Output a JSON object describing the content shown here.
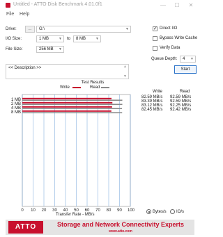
{
  "window": {
    "title": "Untitled - ATTO Disk Benchmark 4.01.0f1",
    "minimize_glyph": "—",
    "maximize_glyph": "☐",
    "close_glyph": "✕"
  },
  "menu": {
    "file": "File",
    "help": "Help"
  },
  "form": {
    "drive_label": "Drive:",
    "drive_browse": "...",
    "drive_value": "G:\\",
    "io_size_label": "I/O Size:",
    "io_from": "1 MB",
    "io_to_label": "to",
    "io_to": "8 MB",
    "file_size_label": "File Size:",
    "file_size": "256 MB",
    "description_placeholder": "<< Description >>"
  },
  "options": {
    "direct_io": "Direct I/O",
    "bypass_write_cache": "Bypass Write Cache",
    "verify_data": "Verify Data",
    "queue_depth_label": "Queue Depth:",
    "queue_depth": "4",
    "start": "Start"
  },
  "chart_data": {
    "type": "bar",
    "title": "Test Results",
    "legend": [
      "Write",
      "Read"
    ],
    "categories": [
      "1 MB",
      "2 MB",
      "4 MB",
      "8 MB"
    ],
    "series": [
      {
        "name": "Write",
        "values": [
          82.59,
          83.39,
          83.12,
          82.45
        ],
        "color": "#c8102e"
      },
      {
        "name": "Read",
        "values": [
          92.59,
          92.59,
          92.25,
          92.42
        ],
        "color": "#8a8a8a"
      }
    ],
    "xlabel": "Transfer Rate - MB/s",
    "xticks": [
      "0",
      "10",
      "20",
      "30",
      "40",
      "50",
      "60",
      "70",
      "80",
      "90",
      "100"
    ],
    "xlim": [
      0,
      100
    ],
    "grid": true
  },
  "results": {
    "write_header": "Write",
    "read_header": "Read",
    "rows": [
      {
        "write": "82.59 MB/s",
        "read": "92.59 MB/s"
      },
      {
        "write": "83.39 MB/s",
        "read": "92.59 MB/s"
      },
      {
        "write": "83.12 MB/s",
        "read": "92.25 MB/s"
      },
      {
        "write": "82.45 MB/s",
        "read": "92.42 MB/s"
      }
    ]
  },
  "units": {
    "bytes": "Bytes/s",
    "io": "IO/s"
  },
  "banner": {
    "logo": "ATTO",
    "tagline": "Storage and Network Connectivity Experts",
    "url": "www.atto.com"
  },
  "colors": {
    "accent": "#c8102e",
    "read_bar": "#8a8a8a",
    "grid": "#6fa0d8"
  }
}
